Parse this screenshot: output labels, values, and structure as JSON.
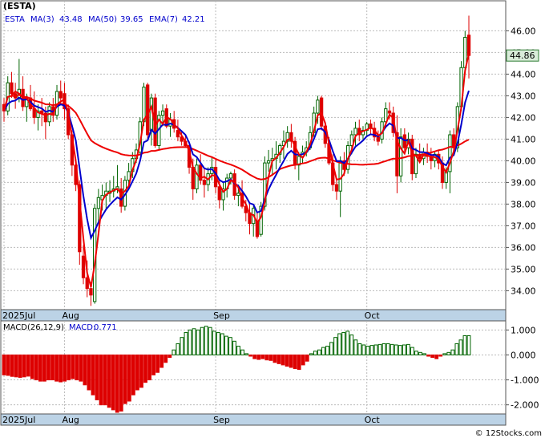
{
  "chart_data": [
    {
      "type": "candlestick",
      "title": "(ESTA)",
      "legend": {
        "symbol": "ESTA",
        "items": [
          {
            "label": "MA(3)",
            "value": "43.48",
            "color": "#0000cc"
          },
          {
            "label": "MA(50)",
            "value": "39.65",
            "color": "#0000cc"
          },
          {
            "label": "EMA(7)",
            "value": "42.21",
            "color": "#0000cc"
          }
        ]
      },
      "last_price_label": "44.86",
      "ylim": [
        33.2,
        47.2
      ],
      "y_ticks": [
        "34.00",
        "35.00",
        "36.00",
        "37.00",
        "38.00",
        "39.00",
        "40.00",
        "41.00",
        "42.00",
        "43.00",
        "44.00",
        "45.00",
        "46.00"
      ],
      "y_tick_values": [
        34,
        35,
        36,
        37,
        38,
        39,
        40,
        41,
        42,
        43,
        44,
        45,
        46
      ],
      "x_labels": [
        {
          "label": "2025Jul",
          "index": 0
        },
        {
          "label": "Aug",
          "index": 16
        },
        {
          "label": "Sep",
          "index": 56
        },
        {
          "label": "Oct",
          "index": 96
        }
      ],
      "ohlc": [
        [
          42.6,
          42.9,
          41.8,
          42.3
        ],
        [
          42.3,
          43.9,
          42.1,
          43.6
        ],
        [
          43.6,
          44.1,
          42.9,
          43.1
        ],
        [
          43.1,
          43.6,
          42.4,
          42.9
        ],
        [
          42.9,
          44.7,
          42.7,
          43.3
        ],
        [
          43.3,
          43.9,
          42.3,
          42.5
        ],
        [
          42.5,
          43.1,
          41.8,
          42.9
        ],
        [
          42.9,
          43.5,
          42.3,
          42.4
        ],
        [
          42.4,
          43.2,
          41.7,
          42.0
        ],
        [
          42.0,
          42.6,
          41.4,
          42.3
        ],
        [
          42.3,
          42.9,
          41.6,
          42.2
        ],
        [
          42.2,
          42.5,
          41.0,
          41.8
        ],
        [
          41.8,
          42.7,
          41.6,
          42.5
        ],
        [
          42.5,
          42.9,
          41.8,
          42.1
        ],
        [
          42.1,
          43.5,
          41.9,
          43.2
        ],
        [
          43.2,
          43.7,
          42.6,
          42.9
        ],
        [
          43.1,
          43.6,
          41.9,
          42.4
        ],
        [
          42.4,
          42.6,
          41.0,
          41.2
        ],
        [
          41.2,
          41.4,
          39.3,
          39.8
        ],
        [
          39.8,
          40.1,
          38.6,
          38.9
        ],
        [
          38.9,
          39.1,
          35.2,
          35.8
        ],
        [
          35.6,
          36.1,
          34.3,
          34.6
        ],
        [
          34.6,
          35.4,
          33.7,
          34.1
        ],
        [
          34.1,
          34.4,
          33.3,
          33.8
        ],
        [
          33.5,
          38.0,
          33.4,
          37.8
        ],
        [
          37.8,
          38.7,
          37.1,
          38.3
        ],
        [
          38.2,
          38.9,
          37.7,
          38.4
        ],
        [
          38.4,
          39.0,
          37.8,
          38.6
        ],
        [
          38.5,
          39.1,
          38.1,
          38.6
        ],
        [
          38.6,
          39.3,
          38.3,
          38.7
        ],
        [
          38.7,
          39.8,
          38.5,
          38.8
        ],
        [
          38.7,
          39.2,
          37.6,
          37.9
        ],
        [
          37.9,
          39.3,
          37.7,
          39.1
        ],
        [
          39.1,
          39.9,
          38.8,
          39.5
        ],
        [
          39.5,
          40.4,
          39.2,
          40.1
        ],
        [
          40.1,
          40.8,
          39.9,
          40.5
        ],
        [
          40.4,
          42.0,
          40.3,
          41.8
        ],
        [
          41.8,
          43.6,
          41.6,
          43.4
        ],
        [
          43.5,
          43.6,
          41.0,
          41.2
        ],
        [
          41.4,
          43.1,
          40.7,
          42.9
        ],
        [
          42.9,
          43.1,
          40.6,
          40.7
        ],
        [
          40.7,
          42.3,
          40.5,
          42.1
        ],
        [
          42.1,
          42.6,
          41.6,
          42.3
        ],
        [
          42.4,
          42.6,
          41.5,
          41.6
        ],
        [
          41.6,
          42.2,
          41.1,
          41.9
        ],
        [
          41.9,
          42.3,
          41.3,
          41.5
        ],
        [
          41.4,
          41.9,
          40.9,
          41.1
        ],
        [
          41.1,
          41.4,
          40.7,
          40.9
        ],
        [
          40.9,
          41.2,
          40.6,
          40.7
        ],
        [
          40.7,
          40.9,
          39.4,
          39.7
        ],
        [
          39.7,
          40.1,
          38.2,
          38.7
        ],
        [
          38.7,
          40.1,
          38.5,
          39.8
        ],
        [
          39.8,
          40.3,
          38.9,
          39.1
        ],
        [
          39.1,
          39.7,
          38.3,
          38.9
        ],
        [
          38.9,
          39.7,
          38.6,
          39.4
        ],
        [
          39.4,
          40.2,
          39.1,
          39.7
        ],
        [
          39.7,
          40.1,
          38.5,
          38.8
        ],
        [
          38.8,
          39.1,
          37.8,
          38.2
        ],
        [
          38.2,
          39.0,
          37.7,
          38.7
        ],
        [
          38.7,
          39.4,
          38.3,
          39.2
        ],
        [
          39.2,
          39.5,
          38.9,
          39.4
        ],
        [
          39.4,
          39.6,
          38.2,
          38.4
        ],
        [
          38.4,
          38.9,
          37.9,
          38.5
        ],
        [
          38.5,
          39.1,
          37.8,
          37.9
        ],
        [
          37.9,
          38.2,
          37.2,
          37.6
        ],
        [
          37.6,
          38.1,
          36.6,
          37.1
        ],
        [
          37.1,
          37.9,
          36.5,
          37.8
        ],
        [
          37.2,
          37.6,
          36.4,
          36.5
        ],
        [
          36.6,
          38.1,
          36.5,
          37.9
        ],
        [
          37.9,
          40.2,
          37.7,
          39.9
        ],
        [
          39.9,
          40.5,
          39.5,
          40.0
        ],
        [
          40.0,
          40.6,
          39.3,
          40.1
        ],
        [
          40.1,
          40.9,
          39.6,
          40.3
        ],
        [
          40.3,
          40.8,
          39.9,
          40.7
        ],
        [
          40.7,
          41.4,
          40.1,
          40.9
        ],
        [
          40.9,
          41.6,
          40.6,
          41.3
        ],
        [
          41.3,
          41.7,
          40.6,
          40.9
        ],
        [
          40.9,
          41.1,
          39.6,
          39.8
        ],
        [
          39.8,
          40.4,
          39.1,
          40.2
        ],
        [
          40.2,
          40.7,
          39.9,
          40.4
        ],
        [
          40.4,
          40.9,
          40.2,
          40.6
        ],
        [
          40.6,
          41.6,
          40.5,
          41.3
        ],
        [
          41.3,
          42.5,
          41.1,
          42.2
        ],
        [
          42.2,
          43.0,
          41.7,
          42.8
        ],
        [
          42.9,
          43.0,
          41.4,
          41.6
        ],
        [
          41.6,
          41.8,
          40.6,
          40.8
        ],
        [
          40.8,
          41.1,
          39.8,
          39.9
        ],
        [
          39.9,
          40.3,
          38.6,
          38.9
        ],
        [
          38.9,
          39.2,
          38.2,
          38.6
        ],
        [
          38.6,
          40.2,
          37.4,
          40.0
        ],
        [
          40.0,
          40.4,
          39.3,
          39.6
        ],
        [
          39.6,
          40.9,
          39.4,
          40.7
        ],
        [
          40.7,
          41.4,
          40.3,
          41.2
        ],
        [
          41.2,
          41.8,
          40.7,
          41.5
        ],
        [
          41.5,
          41.9,
          40.9,
          41.2
        ],
        [
          41.2,
          41.6,
          40.9,
          41.4
        ],
        [
          41.4,
          41.8,
          41.1,
          41.7
        ],
        [
          41.7,
          41.9,
          41.2,
          41.5
        ],
        [
          41.5,
          41.8,
          40.9,
          41.1
        ],
        [
          41.1,
          41.4,
          40.7,
          40.9
        ],
        [
          41.0,
          42.0,
          40.8,
          41.8
        ],
        [
          41.8,
          42.7,
          41.5,
          42.4
        ],
        [
          42.3,
          42.7,
          41.9,
          42.2
        ],
        [
          42.2,
          42.5,
          41.1,
          41.3
        ],
        [
          41.3,
          42.1,
          38.5,
          39.3
        ],
        [
          39.3,
          41.5,
          39.0,
          41.1
        ],
        [
          41.2,
          41.5,
          40.4,
          40.6
        ],
        [
          40.6,
          41.3,
          40.3,
          41.0
        ],
        [
          41.0,
          41.2,
          39.1,
          39.4
        ],
        [
          39.4,
          40.6,
          39.2,
          40.3
        ],
        [
          40.3,
          40.8,
          39.9,
          40.1
        ],
        [
          40.1,
          40.6,
          39.8,
          40.4
        ],
        [
          40.4,
          40.8,
          39.9,
          40.2
        ],
        [
          40.2,
          40.6,
          39.6,
          40.0
        ],
        [
          40.0,
          40.4,
          39.7,
          40.3
        ],
        [
          40.3,
          40.5,
          39.6,
          39.9
        ],
        [
          39.9,
          40.2,
          38.7,
          39.0
        ],
        [
          39.0,
          39.7,
          38.7,
          39.5
        ],
        [
          39.5,
          41.4,
          38.5,
          41.2
        ],
        [
          41.2,
          41.5,
          40.3,
          40.6
        ],
        [
          40.6,
          42.7,
          40.4,
          42.5
        ],
        [
          42.5,
          44.6,
          42.3,
          44.3
        ],
        [
          44.3,
          46.0,
          44.0,
          45.7
        ],
        [
          45.8,
          46.7,
          43.8,
          44.86
        ]
      ]
    },
    {
      "type": "bar",
      "title": "MACD(26,12,9)",
      "legend": {
        "label": "MACD(26,12,9)",
        "value_label": "MACD:",
        "value": "0.771"
      },
      "ylim": [
        -2.3,
        1.3
      ],
      "y_ticks": [
        "1.000",
        "0.000",
        "-1.000",
        "-2.000"
      ],
      "y_tick_values": [
        1,
        0,
        -1,
        -2
      ],
      "x_labels": [
        {
          "label": "2025Jul",
          "index": 0
        },
        {
          "label": "Aug",
          "index": 16
        },
        {
          "label": "Sep",
          "index": 56
        },
        {
          "label": "Oct",
          "index": 96
        }
      ],
      "values": [
        -0.8,
        -0.82,
        -0.86,
        -0.88,
        -0.9,
        -0.88,
        -0.85,
        -0.95,
        -1.0,
        -1.05,
        -1.05,
        -1.0,
        -1.0,
        -1.05,
        -1.08,
        -1.05,
        -1.0,
        -0.95,
        -1.0,
        -1.05,
        -1.2,
        -1.4,
        -1.6,
        -1.8,
        -2.0,
        -2.0,
        -2.1,
        -2.2,
        -2.3,
        -2.25,
        -1.95,
        -1.85,
        -1.6,
        -1.4,
        -1.3,
        -1.1,
        -1.0,
        -0.8,
        -0.7,
        -0.5,
        -0.3,
        -0.1,
        0.2,
        0.45,
        0.7,
        0.9,
        1.0,
        1.05,
        1.0,
        1.1,
        1.15,
        1.1,
        0.95,
        0.9,
        0.85,
        0.75,
        0.7,
        0.55,
        0.35,
        0.2,
        0.05,
        -0.05,
        -0.15,
        -0.18,
        -0.15,
        -0.2,
        -0.22,
        -0.3,
        -0.35,
        -0.4,
        -0.45,
        -0.5,
        -0.55,
        -0.58,
        -0.4,
        -0.25,
        0.05,
        0.15,
        0.2,
        0.3,
        0.35,
        0.5,
        0.7,
        0.85,
        0.9,
        0.95,
        0.8,
        0.6,
        0.45,
        0.4,
        0.35,
        0.38,
        0.4,
        0.42,
        0.45,
        0.45,
        0.42,
        0.4,
        0.38,
        0.4,
        0.42,
        0.3,
        0.15,
        0.1,
        0.05,
        -0.05,
        -0.1,
        -0.15,
        -0.05,
        0.05,
        0.1,
        0.2,
        0.45,
        0.6,
        0.77,
        0.771
      ]
    }
  ],
  "watermark": "© 12Stocks.com",
  "colors": {
    "up": "#006400",
    "down": "#dd0000",
    "ma": "#0000cc",
    "ema": "#ee0000",
    "axis_band": "#bcd3e6"
  }
}
